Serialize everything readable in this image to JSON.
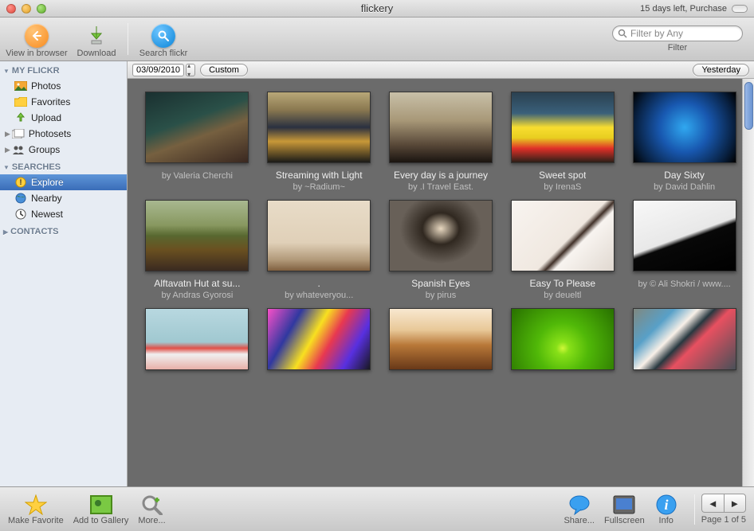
{
  "window": {
    "title": "flickery",
    "purchase": "15 days left, Purchase"
  },
  "toolbar": {
    "view": "View in browser",
    "download": "Download",
    "search": "Search flickr",
    "filter_placeholder": "Filter by Any",
    "filter_label": "Filter"
  },
  "sidebar": {
    "section_myflickr": "MY FLICKR",
    "photos": "Photos",
    "favorites": "Favorites",
    "upload": "Upload",
    "photosets": "Photosets",
    "groups": "Groups",
    "section_searches": "SEARCHES",
    "explore": "Explore",
    "nearby": "Nearby",
    "newest": "Newest",
    "section_contacts": "CONTACTS"
  },
  "datebar": {
    "date": "03/09/2010",
    "custom": "Custom",
    "yesterday": "Yesterday"
  },
  "photos": [
    {
      "title": "",
      "author": "by Valeria Cherchi"
    },
    {
      "title": "Streaming with Light",
      "author": "by ~Radium~"
    },
    {
      "title": "Every day is a journey",
      "author": "by .I Travel East."
    },
    {
      "title": "Sweet spot",
      "author": "by IrenaS"
    },
    {
      "title": "Day Sixty",
      "author": "by David Dahlin"
    },
    {
      "title": "Alftavatn Hut at su...",
      "author": "by Andras Gyorosi"
    },
    {
      "title": ".",
      "author": "by whateveryou..."
    },
    {
      "title": "Spanish Eyes",
      "author": "by pirus"
    },
    {
      "title": "Easy To Please",
      "author": "by deueltl"
    },
    {
      "title": "",
      "author": "by © Ali Shokri / www...."
    }
  ],
  "bottom": {
    "fav": "Make Favorite",
    "gallery": "Add to Gallery",
    "more": "More...",
    "share": "Share...",
    "fullscreen": "Fullscreen",
    "info": "Info",
    "page": "Page 1 of 5"
  }
}
